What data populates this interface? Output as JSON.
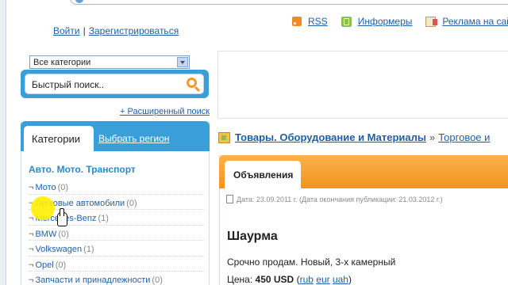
{
  "auth": {
    "login": "Войти",
    "separator": "|",
    "register": "Зарегистрироваться"
  },
  "topnav": [
    {
      "label": "RSS",
      "icon": "rss-icon"
    },
    {
      "label": "Информеры",
      "icon": "informer-icon"
    },
    {
      "label": "Реклама на сайт",
      "icon": "advertising-icon"
    }
  ],
  "category_select": {
    "value": "Все категории"
  },
  "search": {
    "placeholder": "Быстрый поиск.."
  },
  "advanced_search": "+ Расширенный поиск",
  "sidebar_tabs": {
    "categories": "Категории",
    "region": "Выбрать регион"
  },
  "category_section": {
    "heading": "Авто. Мото. Транспорт",
    "items": [
      {
        "label": "Мото",
        "count": "(0)"
      },
      {
        "label": "Легковые автомобили",
        "count": "(0)"
      },
      {
        "label": "Mercedes-Benz",
        "count": "(1)"
      },
      {
        "label": "BMW",
        "count": "(0)"
      },
      {
        "label": "Volkswagen",
        "count": "(1)"
      },
      {
        "label": "Opel",
        "count": "(0)"
      },
      {
        "label": "Запчасти и принадлежности",
        "count": "(0)"
      }
    ],
    "item_marker": "¬"
  },
  "breadcrumb": {
    "main": "Товары. Оборудование и Материалы",
    "separator": "»",
    "sub": "Торговое и"
  },
  "ads_tab": "Объявления",
  "listing": {
    "date_line": "Дата: 23.09.2011 г. (Дата окончания публикации: 21.03.2012 г.)",
    "title": "Шаурма",
    "description": "Срочно продам. Новый, 3-х камерный",
    "price_label": "Цена:",
    "price_value": "450 USD",
    "currency_links": [
      "rub",
      "eur",
      "uah"
    ]
  },
  "colors": {
    "link": "#1f5fa8",
    "sidebar_blue": "#3a9fd8",
    "ads_orange": "#f39321",
    "heading_blue": "#2a8ac8"
  }
}
